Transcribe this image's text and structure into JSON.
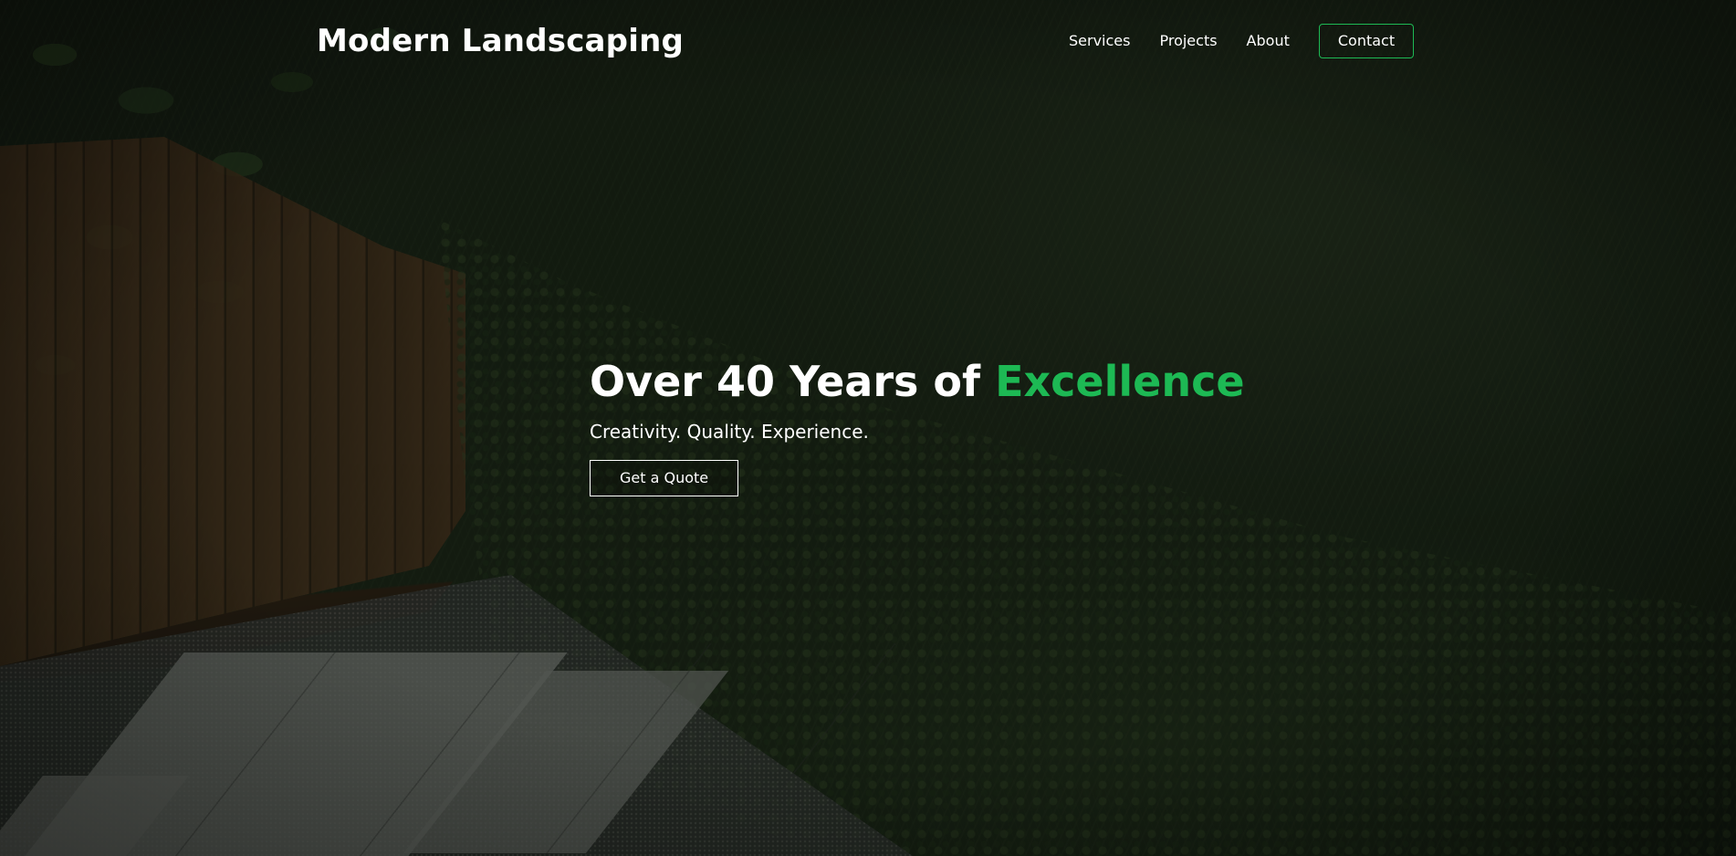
{
  "brand": {
    "name": "Modern Landscaping"
  },
  "nav": {
    "items": [
      {
        "label": "Services"
      },
      {
        "label": "Projects"
      },
      {
        "label": "About"
      }
    ],
    "contact_label": "Contact"
  },
  "hero": {
    "title_prefix": "Over 40 Years of ",
    "title_accent": "Excellence",
    "subtitle": "Creativity. Quality. Experience.",
    "cta_label": "Get a Quote"
  },
  "colors": {
    "accent": "#1db954",
    "text": "#ffffff",
    "overlay": "#0a0e0a"
  }
}
